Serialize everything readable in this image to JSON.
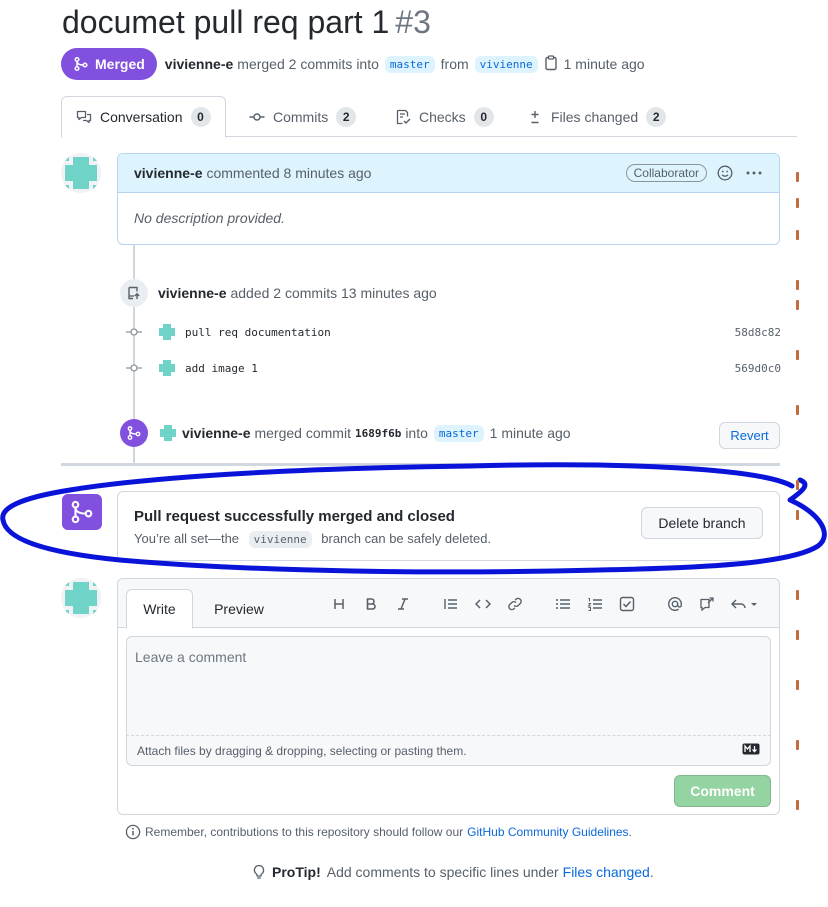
{
  "pr": {
    "title": "documet pull req part 1",
    "number": "#3",
    "state": "Merged",
    "author": "vivienne-e",
    "merge_summary": "merged 2 commits into",
    "base_branch": "master",
    "from_word": "from",
    "head_branch": "vivienne",
    "time": "1 minute ago"
  },
  "tabs": [
    {
      "label": "Conversation",
      "count": "0"
    },
    {
      "label": "Commits",
      "count": "2"
    },
    {
      "label": "Checks",
      "count": "0"
    },
    {
      "label": "Files changed",
      "count": "2"
    }
  ],
  "comment": {
    "author": "vivienne-e",
    "action": "commented 8 minutes ago",
    "role": "Collaborator",
    "body": "No description provided."
  },
  "commits_event": {
    "author": "vivienne-e",
    "action": "added 2 commits 13 minutes ago",
    "commits": [
      {
        "message": "pull req documentation",
        "sha": "58d8c82"
      },
      {
        "message": "add image 1",
        "sha": "569d0c0"
      }
    ]
  },
  "merge_event": {
    "author": "vivienne-e",
    "action": "merged commit",
    "sha": "1689f6b",
    "into": "into",
    "branch": "master",
    "time": "1 minute ago",
    "revert_label": "Revert"
  },
  "merged_box": {
    "title": "Pull request successfully merged and closed",
    "sub_before": "You’re all set—the",
    "branch": "vivienne",
    "sub_after": "branch can be safely deleted.",
    "delete_label": "Delete branch"
  },
  "form": {
    "write_tab": "Write",
    "preview_tab": "Preview",
    "placeholder": "Leave a comment",
    "attach_text": "Attach files by dragging & dropping, selecting or pasting them.",
    "submit_label": "Comment"
  },
  "footer": {
    "guidelines_text": "Remember, contributions to this repository should follow our",
    "guidelines_link": "GitHub Community Guidelines",
    "guidelines_end": ".",
    "protip_label": "ProTip!",
    "protip_text": "Add comments to specific lines under",
    "protip_link": "Files changed",
    "protip_end": "."
  },
  "colors": {
    "merged_purple": "#8250df",
    "link_blue": "#0969da",
    "annotation_blue": "#0a14d9",
    "avatar_teal": "#6fd3c8"
  }
}
